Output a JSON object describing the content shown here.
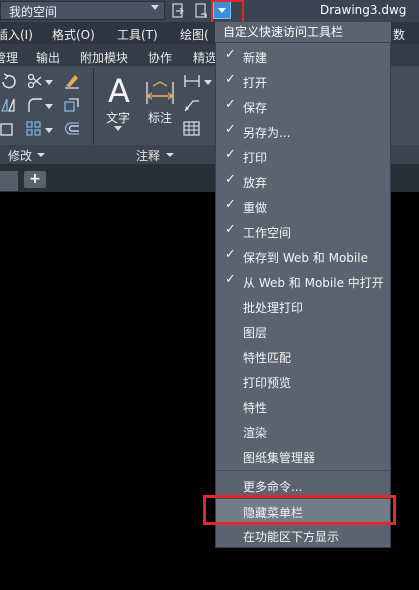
{
  "titlebar": {
    "workspace": "我的空间",
    "document_title": "Drawing3.dwg"
  },
  "menubar": {
    "items": [
      "插入(I)",
      "格式(O)",
      "工具(T)",
      "绘图(",
      "数(P)"
    ]
  },
  "ribbon_tabs": [
    "管理",
    "输出",
    "附加模块",
    "协作",
    "精选"
  ],
  "ribbon": {
    "text_tool": "文字",
    "dim_tool": "标注",
    "panel_modify": "修改",
    "panel_annotate": "注释"
  },
  "dropdown": {
    "header": "自定义快速访问工具栏",
    "items": [
      {
        "label": "新建",
        "checked": "✓"
      },
      {
        "label": "打开",
        "checked": "✓"
      },
      {
        "label": "保存",
        "checked": "✓"
      },
      {
        "label": "另存为...",
        "checked": "✓"
      },
      {
        "label": "打印",
        "checked": "✓"
      },
      {
        "label": "放弃",
        "checked": "✓"
      },
      {
        "label": "重做",
        "checked": "✓"
      },
      {
        "label": "工作空间",
        "checked": "✓"
      },
      {
        "label": "保存到 Web 和 Mobile",
        "checked": "✓"
      },
      {
        "label": "从 Web 和 Mobile 中打开",
        "checked": "✓"
      },
      {
        "label": "批处理打印",
        "checked": ""
      },
      {
        "label": "图层",
        "checked": ""
      },
      {
        "label": "特性匹配",
        "checked": ""
      },
      {
        "label": "打印预览",
        "checked": ""
      },
      {
        "label": "特性",
        "checked": ""
      },
      {
        "label": "渲染",
        "checked": ""
      },
      {
        "label": "图纸集管理器",
        "checked": ""
      }
    ],
    "more_commands": "更多命令...",
    "hide_menubar": "隐藏菜单栏",
    "show_below_ribbon": "在功能区下方显示"
  },
  "colors": {
    "highlight_box": "#e02a2a",
    "menu_bg": "#5b6370",
    "accent": "#3b8fd6"
  }
}
